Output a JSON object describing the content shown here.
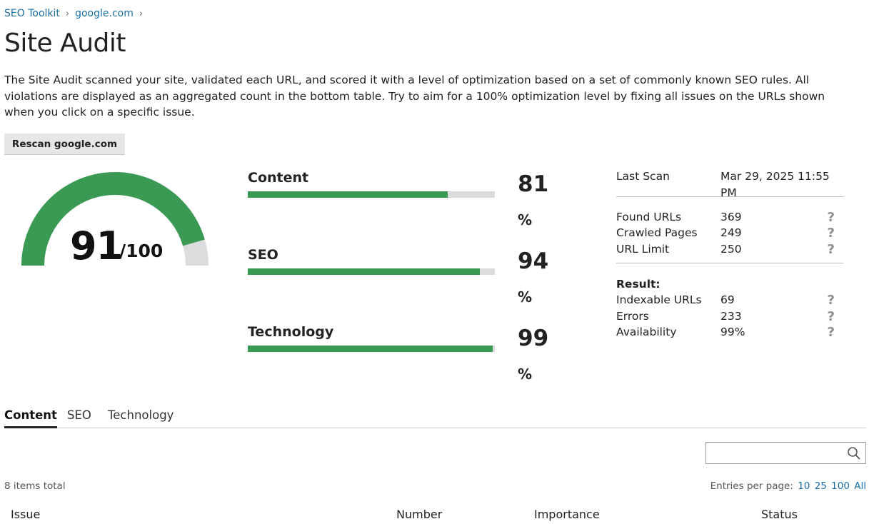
{
  "breadcrumb": {
    "items": [
      "SEO Toolkit",
      "google.com"
    ]
  },
  "page": {
    "title": "Site Audit",
    "description": "The Site Audit scanned your site, validated each URL, and scored it with a level of optimization based on a set of commonly known SEO rules. All violations are displayed as an aggregated count in the bottom table. Try to aim for a 100% optimization level by fixing all issues on the URLs shown when you click on a specific issue."
  },
  "toolbar": {
    "rescan_label": "Rescan google.com"
  },
  "score": {
    "value": "91",
    "max": "/100",
    "fraction": 0.91,
    "color": "#3a9a54",
    "track_color": "#dcdcdc"
  },
  "categories": [
    {
      "label": "Content",
      "value": "81",
      "unit": "%",
      "percent": 81
    },
    {
      "label": "SEO",
      "value": "94",
      "unit": "%",
      "percent": 94
    },
    {
      "label": "Technology",
      "value": "99",
      "unit": "%",
      "percent": 99
    }
  ],
  "stats": {
    "last_scan_label": "Last Scan",
    "last_scan_value": "Mar 29, 2025 11:55 PM",
    "crawl": [
      {
        "label": "Found URLs",
        "value": "369"
      },
      {
        "label": "Crawled Pages",
        "value": "249"
      },
      {
        "label": "URL Limit",
        "value": "250"
      }
    ],
    "result_label": "Result:",
    "results": [
      {
        "label": "Indexable URLs",
        "value": "69"
      },
      {
        "label": "Errors",
        "value": "233"
      },
      {
        "label": "Availability",
        "value": "99%"
      }
    ],
    "help_glyph": "?"
  },
  "tabs": [
    "Content",
    "SEO",
    "Technology"
  ],
  "search": {
    "placeholder": "",
    "icon": "search-icon"
  },
  "table": {
    "total": "8 items total",
    "per_page_label": "Entries per page:",
    "per_page_options": [
      "10",
      "25",
      "100",
      "All"
    ],
    "columns": [
      "Issue",
      "Number",
      "Importance",
      "Status"
    ]
  }
}
